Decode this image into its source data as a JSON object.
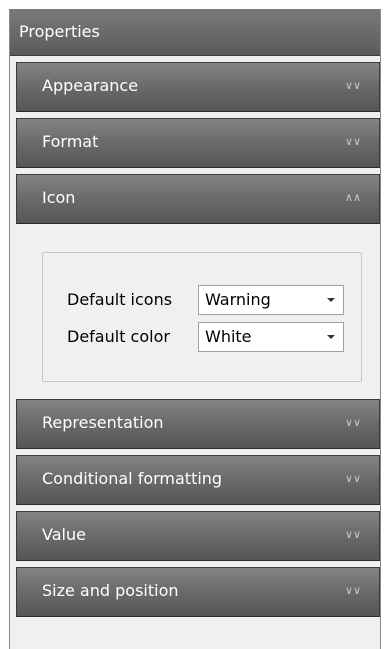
{
  "panel": {
    "title": "Properties"
  },
  "sections_top": [
    {
      "label": "Appearance",
      "state": "collapsed"
    },
    {
      "label": "Format",
      "state": "collapsed"
    },
    {
      "label": "Icon",
      "state": "expanded"
    }
  ],
  "icon_section": {
    "default_icons_label": "Default icons",
    "default_icons_value": "Warning",
    "default_color_label": "Default color",
    "default_color_value": "White"
  },
  "sections_bottom": [
    {
      "label": "Representation",
      "state": "collapsed"
    },
    {
      "label": "Conditional formatting",
      "state": "collapsed"
    },
    {
      "label": "Value",
      "state": "collapsed"
    },
    {
      "label": "Size and position",
      "state": "collapsed"
    }
  ],
  "icons": {
    "collapsed": "chevron-double-down-icon",
    "expanded": "chevron-double-up-icon"
  }
}
